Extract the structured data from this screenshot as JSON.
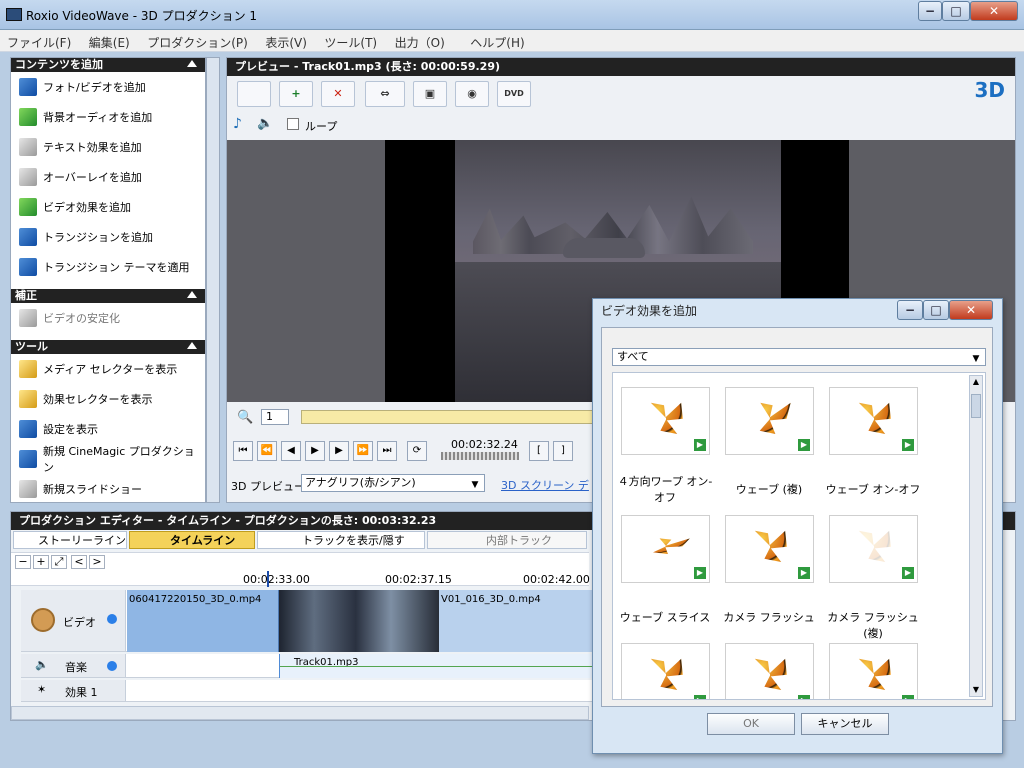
{
  "window": {
    "title": "Roxio VideoWave - 3D プロダクション 1",
    "min": "−",
    "max": "□",
    "close": "✕"
  },
  "menu": [
    "ファイル(F)",
    "編集(E)",
    "プロダクション(P)",
    "表示(V)",
    "ツール(T)",
    "出力（O)",
    "ヘルプ(H)"
  ],
  "left": {
    "content_title": "コンテンツを追加",
    "content_items": [
      "フォト/ビデオを追加",
      "背景オーディオを追加",
      "テキスト効果を追加",
      "オーバーレイを追加",
      "ビデオ効果を追加",
      "トランジションを追加",
      "トランジション テーマを適用"
    ],
    "fix_title": "補正",
    "fix_item": "ビデオの安定化",
    "tools_title": "ツール",
    "tools_items": [
      "メディア セレクターを表示",
      "効果セレクターを表示",
      "設定を表示",
      "新規 CineMagic プロダクション",
      "新規スライドショー"
    ]
  },
  "preview": {
    "header": "プレビュー - Track01.mp3 (長さ: 00:00:59.29)",
    "loop_label": "ループ",
    "frame_number": "1",
    "timecode": "00:02:32.24",
    "mode_label": "3D プレビュー:",
    "mode_value": "アナグリフ(赤/シアン)",
    "link_text": "3D スクリーン デ",
    "badge_3d": "3D",
    "dvd_label": "DVD"
  },
  "timeline": {
    "header": "プロダクション エディター - タイムライン - プロダクションの長さ: 00:03:32.23",
    "tabs": [
      "ストーリーライン",
      "タイムライン",
      "トラックを表示/隠す",
      "内部トラック"
    ],
    "ticks": [
      "00:02:33.00",
      "00:02:37.15",
      "00:02:42.00"
    ],
    "tracks": [
      {
        "label": "ビデオ"
      },
      {
        "label": "音楽"
      },
      {
        "label": "効果 1"
      }
    ],
    "clip1": "060417220150_3D_0.mp4",
    "clip2": "V01_016_3D_0.mp4",
    "audio_clip": "Track01.mp3"
  },
  "dialog": {
    "title": "ビデオ効果を追加",
    "filter": "すべて",
    "effects": [
      {
        "label": "４方向ワープ オン-オフ"
      },
      {
        "label": "ウェーブ (複)"
      },
      {
        "label": "ウェーブ オン-オフ"
      },
      {
        "label": "ウェーブ スライス"
      },
      {
        "label": "カメラ フラッシュ"
      },
      {
        "label": "カメラ フラッシュ (複)"
      },
      {
        "label": ""
      },
      {
        "label": ""
      },
      {
        "label": ""
      }
    ],
    "ok": "OK",
    "cancel": "キャンセル",
    "min": "−",
    "max": "□",
    "close": "✕"
  }
}
